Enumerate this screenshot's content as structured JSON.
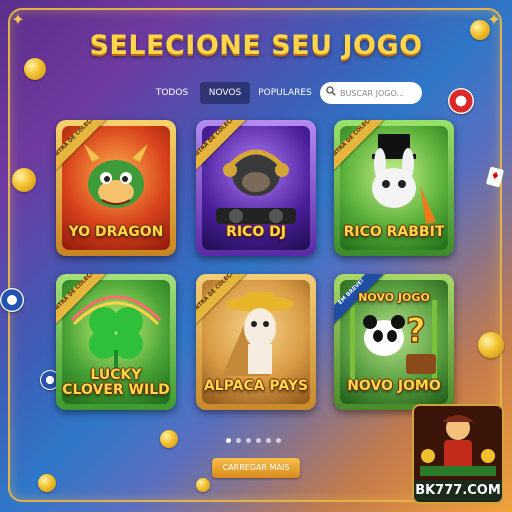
{
  "page": {
    "title": "SELECIONE SEU JOGO"
  },
  "tabs": [
    {
      "label": "TODOS",
      "active": false
    },
    {
      "label": "NOVOS",
      "active": true
    },
    {
      "label": "POPULARES",
      "active": false
    }
  ],
  "search": {
    "placeholder": "BUSCAR JOGO...",
    "value": "",
    "icon": "search-icon"
  },
  "games": [
    {
      "name": "YO DRAGON",
      "ribbon": "CONTRA DE COLEÇÃO",
      "icon": "dragon-icon"
    },
    {
      "name": "RICO DJ",
      "ribbon": "CONTRA DE COLEÇÃO",
      "icon": "gorilla-dj-icon"
    },
    {
      "name": "RICO RABBIT",
      "ribbon": "CONTRA DE COLEÇÃO",
      "icon": "rabbit-icon"
    },
    {
      "name": "LUCKY CLOVER WILD",
      "name_line1": "LUCKY",
      "name_line2": "CLOVER WILD",
      "ribbon": "CONTRA DE COLEÇÃO",
      "icon": "clover-icon"
    },
    {
      "name": "ALPACA PAYS",
      "ribbon": "CONTRA DE COLEÇÃO",
      "icon": "alpaca-icon"
    },
    {
      "name": "NOVO JOMO",
      "header": "NOVO JOGO",
      "ribbon": "EM BREVE!",
      "icon": "panda-icon"
    }
  ],
  "pagination": {
    "count": 6,
    "active_index": 0
  },
  "load_more": {
    "label": "CARREGAR MAIS"
  },
  "brand": {
    "site": "BK777.COM"
  },
  "colors": {
    "accent": "#ffd54a",
    "frame": "#e2b24a",
    "button": "#e9a02c"
  }
}
